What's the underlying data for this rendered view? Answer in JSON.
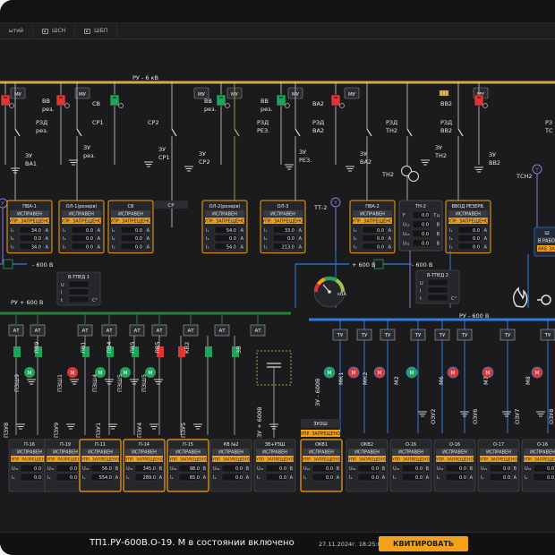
{
  "tabs": [
    {
      "label": "ытий",
      "icon": "none"
    },
    {
      "label": "ШСН",
      "icon": "scheme-icon"
    },
    {
      "label": "ШБП",
      "icon": "scheme-icon"
    }
  ],
  "colors": {
    "bus6kv": "#d6a84a",
    "bus600": "#2e7d32",
    "bus600_right": "#2f7de1",
    "accent": "#f3a11a",
    "red": "#e03535",
    "green": "#1fa35a",
    "panel": "#26272b"
  },
  "labels": {
    "ru6kv": "РУ - 6 кВ",
    "ru600_left": "РУ + 600 В",
    "ru600_right": "РУ - 600 В",
    "bus_minus_left": "- 600 В",
    "bus_plus_mid": "+ 600 В",
    "bus_minus_mid": "- 600 В",
    "mu": "МУ",
    "tt2": "ТТ-2",
    "kva": "кВА",
    "tn2": "ТН2",
    "tsn2": "ТСН2",
    "sr": "СР"
  },
  "top_breakers": [
    {
      "code": "ВВ рез.",
      "pos": "right"
    },
    {
      "code": "СВ",
      "pos": "left"
    },
    {
      "code": "ВВ рез.",
      "pos": "right"
    },
    {
      "code": "ВВ рез.",
      "pos": "right"
    },
    {
      "code": "ВА2",
      "pos": "right"
    },
    {
      "code": "ВВ2",
      "pos": "right"
    }
  ],
  "disconnectors": [
    {
      "l1": "РЗД",
      "l2": "рез."
    },
    {
      "l1": "СР1",
      "l2": ""
    },
    {
      "l1": "СР2",
      "l2": ""
    },
    {
      "l1": "РЗД",
      "l2": "РЕЗ."
    },
    {
      "l1": "РЗД",
      "l2": "ВА2"
    },
    {
      "l1": "РЗД",
      "l2": "ТН2"
    },
    {
      "l1": "РЗД",
      "l2": "ВВ2"
    },
    {
      "l1": "РЗ",
      "l2": "ТС"
    }
  ],
  "grounds": [
    {
      "l1": "ЗУ",
      "l2": "ВА1"
    },
    {
      "l1": "ЗУ",
      "l2": "рез."
    },
    {
      "l1": "ЗУ",
      "l2": "СР1"
    },
    {
      "l1": "ЗУ",
      "l2": "СР2"
    },
    {
      "l1": "ЗУ",
      "l2": "РЕЗ."
    },
    {
      "l1": "ЗУ",
      "l2": "ВА2"
    },
    {
      "l1": "ЗУ",
      "l2": "ТН2"
    },
    {
      "l1": "ЗУ",
      "l2": "ВВ2"
    }
  ],
  "feeder_panels": [
    {
      "title": "ПВА-1",
      "status": "ИСПРАВЕН",
      "ctrl": "УПР. ЗАПРЕЩЕНО",
      "rows": [
        [
          "I₁",
          "34.0",
          "A"
        ],
        [
          "I₂",
          "0.0",
          "A"
        ],
        [
          "I₃",
          "34.0",
          "A"
        ]
      ]
    },
    {
      "title": "ОЛ-1(резерв)",
      "status": "ИСПРАВЕН",
      "ctrl": "УПР. ЗАПРЕЩЕНО",
      "rows": [
        [
          "I₁",
          "0.0",
          "A"
        ],
        [
          "I₂",
          "0.0",
          "A"
        ],
        [
          "I₃",
          "0.0",
          "A"
        ]
      ]
    },
    {
      "title": "СВ",
      "status": "ИСПРАВЕН",
      "ctrl": "УПР. ЗАПРЕЩЕНО",
      "rows": [
        [
          "I₁",
          "0.0",
          "A"
        ],
        [
          "I₂",
          "0.0",
          "A"
        ],
        [
          "I₃",
          "0.0",
          "A"
        ]
      ]
    },
    {
      "title": "ОЛ-2(резерв)",
      "status": "ИСПРАВЕН",
      "ctrl": "УПР. ЗАПРЕЩЕНО",
      "rows": [
        [
          "I₁",
          "54.0",
          "A"
        ],
        [
          "I₂",
          "0.0",
          "A"
        ],
        [
          "I₃",
          "54.0",
          "A"
        ]
      ]
    },
    {
      "title": "ОЛ-3",
      "status": "ИСПРАВЕН",
      "ctrl": "УПР. ЗАПРЕЩЕНО",
      "rows": [
        [
          "I₁",
          "33.0",
          "A"
        ],
        [
          "I₂",
          "0.0",
          "A"
        ],
        [
          "I₃",
          "213.0",
          "A"
        ]
      ]
    },
    {
      "title": "ПВА-2",
      "status": "ИСПРАВЕН",
      "ctrl": "УПР. ЗАПРЕЩЕНО",
      "rows": [
        [
          "I₁",
          "0.0",
          "A"
        ],
        [
          "I₂",
          "0.0",
          "A"
        ],
        [
          "I₃",
          "0.0",
          "A"
        ]
      ]
    },
    {
      "title": "ВВОД РЕЗЕРВ.",
      "status": "ИСПРАВЕН",
      "ctrl": "УПР. ЗАПРЕЩЕНО",
      "rows": [
        [
          "I₁",
          "0.0",
          "A"
        ],
        [
          "I₂",
          "0.0",
          "A"
        ],
        [
          "I₃",
          "0.0",
          "A"
        ]
      ]
    }
  ],
  "tn_panel": {
    "title": "ТН-2",
    "rows": [
      [
        "F",
        "0.0",
        "Гц"
      ],
      [
        "U₁₂",
        "0.0",
        "В"
      ],
      [
        "U₂₃",
        "0.0",
        "В"
      ],
      [
        "U₃₁",
        "0.0",
        "В"
      ]
    ]
  },
  "right_stub_panel": {
    "title": "Ш",
    "status": "В РАБОТ",
    "ctrl": "АКБ ЗАРЯ"
  },
  "vtped_left": {
    "title": "В-ТПЕД 1",
    "rows": [
      [
        "U",
        "",
        ""
      ],
      [
        "I",
        "",
        ""
      ],
      [
        "t",
        "",
        "С°"
      ]
    ]
  },
  "vtped_right": {
    "title": "В-ТПЕД 2",
    "rows": [
      [
        "U",
        "",
        ""
      ],
      [
        "I",
        "",
        ""
      ],
      [
        "t",
        "",
        "С°"
      ]
    ]
  },
  "at_labels": [
    "АТ",
    "АТ",
    "АТ",
    "АТ",
    "АТ",
    "АТ",
    "АТ",
    "АТ",
    "АТ"
  ],
  "left_breakers": [
    "ЛВ9",
    "ЛВ1",
    "ЛВ4",
    "ЛВ5",
    "ЛВ5",
    "КВ2",
    "3В"
  ],
  "left_grounds": [
    {
      "l1": "ПЗШ9"
    },
    {
      "l1": "ПЗШ1"
    },
    {
      "l1": "ПЗШ4"
    },
    {
      "l1": "ПЗШ5"
    },
    {
      "l1": "ПЗШ5"
    }
  ],
  "left_bottom_grounds": [
    "ПЗУ8",
    "ПЗУ9",
    "ПЗУ1",
    "ПЗУ4",
    "ПЗУ5",
    "ЗУ + 600В"
  ],
  "tu_labels": [
    "ТУ",
    "ТУ",
    "ТУ",
    "ТУ",
    "ТУ",
    "ТУ",
    "ТУ",
    "ТУ",
    "ТУ",
    "ТУ"
  ],
  "motors": [
    {
      "code": "МК1",
      "col": "green"
    },
    {
      "code": "МК2",
      "col": "red"
    },
    {
      "code": "М2",
      "col": "green"
    },
    {
      "code": "М6",
      "col": "red"
    },
    {
      "code": "М7",
      "col": "red"
    },
    {
      "code": "М8",
      "col": "red"
    }
  ],
  "motor_left": [
    "ЗУ - 600В"
  ],
  "motor_bottom": [
    "ОЗУ2",
    "ОЗУ6",
    "ОЗУ7",
    "ОЗУ8"
  ],
  "bottom_panels": [
    {
      "title": "П-16",
      "status": "ИСПРАВЕН",
      "ctrl": "УПР. РАЗРЕШЕНО",
      "rows": [
        [
          "U₀₁",
          "0.0",
          "В"
        ],
        [
          "Iₐ",
          "0.0",
          "A"
        ]
      ],
      "sel": false
    },
    {
      "title": "П-19",
      "status": "ИСПРАВЕН",
      "ctrl": "УПР. РАЗРЕШЕНО",
      "rows": [
        [
          "U₀₁",
          "0.0",
          "В"
        ],
        [
          "Iₐ",
          "0.0",
          "A"
        ]
      ],
      "sel": false
    },
    {
      "title": "П-11",
      "status": "ИСПРАВЕН",
      "ctrl": "УПР. ЗАПРЕЩЕНО",
      "rows": [
        [
          "U₀₁",
          "56.0",
          "В"
        ],
        [
          "Iₐ",
          "554.0",
          "A"
        ]
      ],
      "sel": true
    },
    {
      "title": "П-14",
      "status": "ИСПРАВЕН",
      "ctrl": "УПР. ЗАПРЕЩЕНО",
      "rows": [
        [
          "U₀₁",
          "345.0",
          "В"
        ],
        [
          "Iₐ",
          "289.0",
          "A"
        ]
      ],
      "sel": true
    },
    {
      "title": "П-15",
      "status": "ИСПРАВЕН",
      "ctrl": "УПР. ЗАПРЕЩЕНО",
      "rows": [
        [
          "U₀₁",
          "98.0",
          "В"
        ],
        [
          "Iₐ",
          "65.0",
          "A"
        ]
      ],
      "sel": true
    },
    {
      "title": "КВ №2",
      "status": "ИСПРАВЕН",
      "ctrl": "УПР. ЗАПРЕЩЕНО",
      "rows": [
        [
          "U₀₁",
          "0.0",
          "В"
        ],
        [
          "Iₐ",
          "0.0",
          "A"
        ]
      ],
      "sel": false
    },
    {
      "title": "ЗВ+РЗШ",
      "status": "ИСПРАВЕН",
      "ctrl": "УПР. ЗАПРЕЩЕНО",
      "rows": [
        [
          "U₀₁",
          "0.0",
          "В"
        ],
        [
          "Iₐ",
          "0.0",
          "A"
        ]
      ],
      "sel": false
    },
    {
      "title": "ОКВ1",
      "status": "ИСПРАВЕН",
      "ctrl": "УПР. ЗАПРЕЩЕНО",
      "rows": [
        [
          "U₀₁",
          "0.0",
          "В"
        ],
        [
          "Iₐ",
          "0.0",
          "A"
        ]
      ],
      "sel": true
    },
    {
      "title": "ОКВ2",
      "status": "ИСПРАВЕН",
      "ctrl": "УПР. ЗАПРЕЩЕНО",
      "rows": [
        [
          "U₀₁",
          "0.0",
          "В"
        ],
        [
          "Iₐ",
          "0.0",
          "A"
        ]
      ],
      "sel": false
    },
    {
      "title": "О-16",
      "status": "ИСПРАВЕН",
      "ctrl": "УПР. ЗАПРЕЩЕНО",
      "rows": [
        [
          "U₀₁",
          "0.0",
          "В"
        ],
        [
          "Iₐ",
          "0.0",
          "A"
        ]
      ],
      "sel": false
    },
    {
      "title": "О-16",
      "status": "ИСПРАВЕН",
      "ctrl": "УПР. ЗАПРЕЩЕНО",
      "rows": [
        [
          "U₀₁",
          "0.0",
          "В"
        ],
        [
          "Iₐ",
          "0.0",
          "A"
        ]
      ],
      "sel": false
    },
    {
      "title": "О-17",
      "status": "ИСПРАВЕН",
      "ctrl": "УПР. ЗАПРЕЩЕНО",
      "rows": [
        [
          "U₀₁",
          "0.0",
          "В"
        ],
        [
          "Iₐ",
          "0.0",
          "A"
        ]
      ],
      "sel": false
    },
    {
      "title": "О-16",
      "status": "ИСПРАВЕН",
      "ctrl": "УПР. ЗАПРЕЩЕНО",
      "rows": [
        [
          "U₀₁",
          "0.0",
          "В"
        ],
        [
          "Iₐ",
          "0.0",
          "A"
        ]
      ],
      "sel": false
    }
  ],
  "zuosh": {
    "title": "ЗУОШ",
    "ctrl": "УПР. ЗАПРЕЩЕНО"
  },
  "status_bar": {
    "message": "ТП1.РУ-600В.О-19.  М в состоянии включено",
    "timestamp": "27.11.2024г. 18:25:09",
    "ack_label": "КВИТИРОВАТЬ"
  }
}
